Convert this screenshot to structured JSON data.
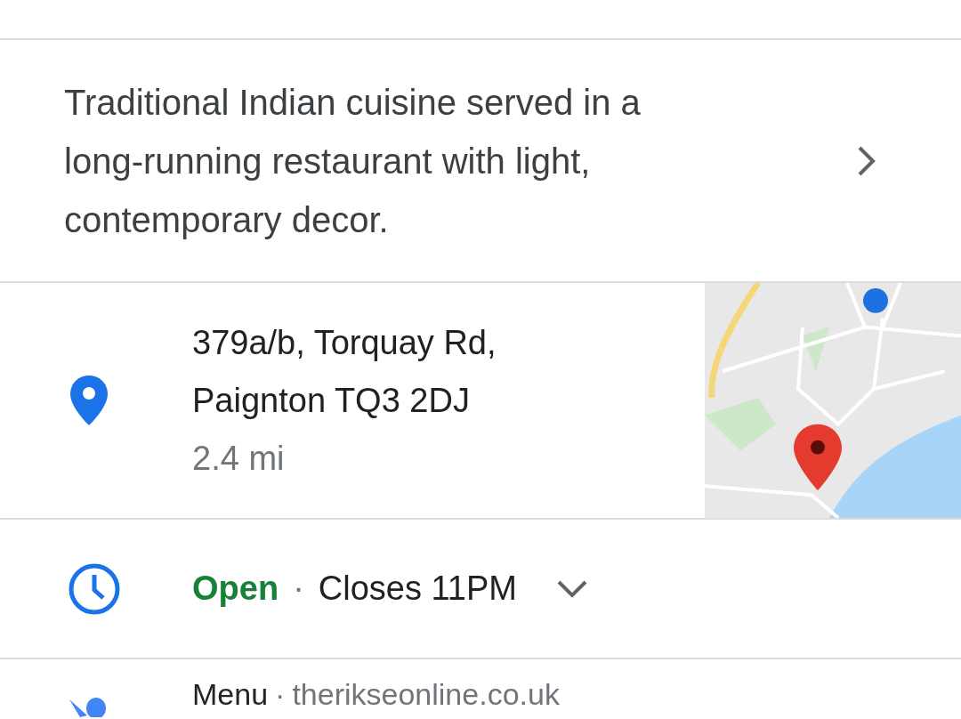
{
  "description": "Traditional Indian cuisine served in a long-running restaurant with light, contemporary decor.",
  "address": {
    "lines": [
      "379a/b, Torquay Rd,",
      "Paignton TQ3 2DJ"
    ],
    "distance": "2.4 mi"
  },
  "hours": {
    "status": "Open",
    "is_open": true,
    "separator": "·",
    "closes": "Closes 11PM",
    "expanded": false
  },
  "menu": {
    "label": "Menu",
    "separator": "·",
    "link": "therikseonline.co.uk"
  }
}
